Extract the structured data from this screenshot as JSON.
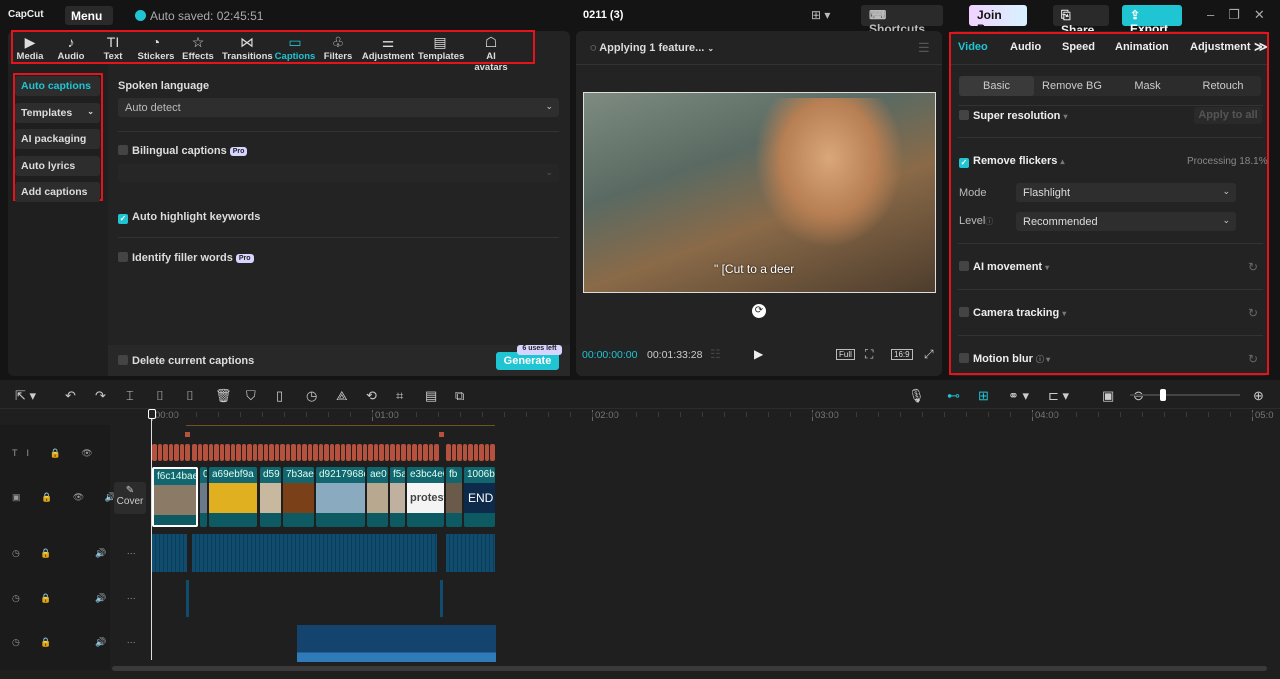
{
  "topbar": {
    "logo": "CapCut",
    "menu": "Menu",
    "autosaved": "Auto saved: 02:45:51",
    "project_title": "0211 (3)",
    "shortcuts": "Shortcuts",
    "join_pro": "Join Pro",
    "share": "Share",
    "export": "Export"
  },
  "toolbar": {
    "items": [
      {
        "label": "Media",
        "icon": "▶"
      },
      {
        "label": "Audio",
        "icon": "♪"
      },
      {
        "label": "Text",
        "icon": "TI"
      },
      {
        "label": "Stickers",
        "icon": "◔"
      },
      {
        "label": "Effects",
        "icon": "☆"
      },
      {
        "label": "Transitions",
        "icon": "⋈"
      },
      {
        "label": "Captions",
        "icon": "▭"
      },
      {
        "label": "Filters",
        "icon": "♧"
      },
      {
        "label": "Adjustment",
        "icon": "⚌"
      },
      {
        "label": "Templates",
        "icon": "▤"
      },
      {
        "label": "AI avatars",
        "icon": "☖"
      }
    ],
    "active": "Captions"
  },
  "captions_nav": {
    "items": [
      "Auto captions",
      "Templates",
      "AI packaging",
      "Auto lyrics",
      "Add captions"
    ],
    "active": "Auto captions"
  },
  "captions": {
    "spoken_language_label": "Spoken language",
    "spoken_language_value": "Auto detect",
    "bilingual": "Bilingual captions",
    "pro": "Pro",
    "auto_highlight": "Auto highlight keywords",
    "auto_highlight_checked": true,
    "filler_words": "Identify filler words",
    "delete_current": "Delete current captions",
    "uses_left": "6 uses left",
    "generate": "Generate"
  },
  "player": {
    "status": "Applying 1 feature...",
    "subtitle": "\" [Cut to a deer",
    "current_time": "00:00:00:00",
    "total_time": "00:01:33:28",
    "full": "Full",
    "ratio": "16:9"
  },
  "inspector": {
    "tabs": [
      "Video",
      "Audio",
      "Speed",
      "Animation",
      "Adjustment"
    ],
    "active_tab": "Video",
    "subtabs": [
      "Basic",
      "Remove BG",
      "Mask",
      "Retouch"
    ],
    "active_subtab": "Basic",
    "apply_all": "Apply to all",
    "super_resolution": "Super resolution",
    "remove_flickers": "Remove flickers",
    "remove_flickers_checked": true,
    "processing": "Processing 18.1%",
    "mode_label": "Mode",
    "mode_value": "Flashlight",
    "level_label": "Level",
    "level_value": "Recommended",
    "ai_movement": "AI movement",
    "camera_tracking": "Camera tracking",
    "motion_blur": "Motion blur"
  },
  "timeline": {
    "ruler": [
      "00:00",
      "01:00",
      "02:00",
      "03:00",
      "04:00",
      "05:0"
    ],
    "cover": "Cover",
    "clips": [
      "f6c14bae",
      "0",
      "a69ebf9a",
      "d59",
      "7b3aec",
      "d9217968c",
      "ae0",
      "f5a",
      "e3bc4e6",
      "fb",
      "1006b7"
    ],
    "clip_texts": {
      "protest": "protest",
      "end": "END"
    },
    "zoom_level": 0.1
  },
  "colors": {
    "accent": "#1fc5d3",
    "caption_track": "#b5513d",
    "video_clip": "#0e5a63",
    "audio_clip": "#0f4c6e",
    "highlight_border": "#e5141c"
  }
}
